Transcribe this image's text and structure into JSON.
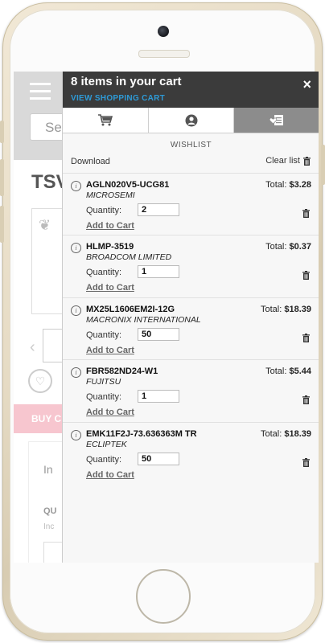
{
  "background_page": {
    "search_placeholder": "Se",
    "title": "TSV",
    "buy_label": "BUY C",
    "section_title": "In",
    "label_1": "QU",
    "label_2": "Inc"
  },
  "cart": {
    "title": "8 items in your cart",
    "view_cart_link": "VIEW SHOPPING CART",
    "close_symbol": "×",
    "tabs": [
      {
        "name": "cart",
        "icon": "cart-icon"
      },
      {
        "name": "account",
        "icon": "user-icon"
      },
      {
        "name": "wishlist",
        "icon": "wishlist-icon",
        "active": true
      }
    ],
    "section_label": "WISHLIST",
    "download_label": "Download",
    "clear_label": "Clear list",
    "quantity_label": "Quantity:",
    "add_to_cart_label": "Add to Cart",
    "total_prefix": "Total:",
    "items": [
      {
        "part": "AGLN020V5-UCG81",
        "manufacturer": "MICROSEMI",
        "total": "$3.28",
        "quantity": "2"
      },
      {
        "part": "HLMP-3519",
        "manufacturer": "BROADCOM LIMITED",
        "total": "$0.37",
        "quantity": "1"
      },
      {
        "part": "MX25L1606EM2I-12G",
        "manufacturer": "MACRONIX INTERNATIONAL",
        "total": "$18.39",
        "quantity": "50"
      },
      {
        "part": "FBR582ND24-W1",
        "manufacturer": "FUJITSU",
        "total": "$5.44",
        "quantity": "1"
      },
      {
        "part": "EMK11F2J-73.636363M TR",
        "manufacturer": "ECLIPTEK",
        "total": "$18.39",
        "quantity": "50"
      }
    ]
  },
  "colors": {
    "header_bg": "#3b3b3b",
    "link": "#2e9ad6",
    "active_tab": "#8c8c8c"
  }
}
